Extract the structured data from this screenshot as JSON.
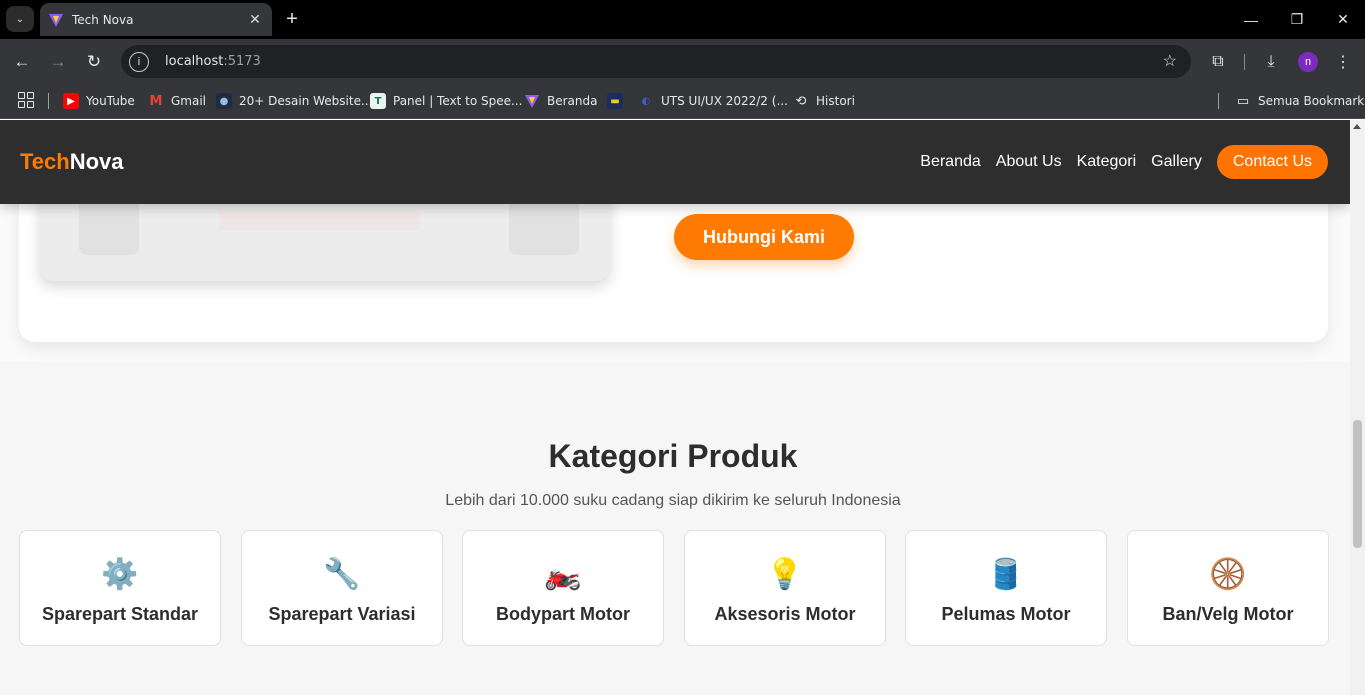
{
  "browser": {
    "tab_title": "Tech Nova",
    "url_host": "localhost",
    "url_port": ":5173",
    "bookmarks": [
      {
        "label": "YouTube",
        "icon": "youtube-icon"
      },
      {
        "label": "Gmail",
        "icon": "gmail-icon"
      },
      {
        "label": "20+ Desain Website...",
        "icon": "site-icon"
      },
      {
        "label": "Panel | Text to Spee...",
        "icon": "t-icon"
      },
      {
        "label": "Beranda",
        "icon": "vite-icon"
      },
      {
        "label": "",
        "icon": "folder-icon"
      },
      {
        "label": "UTS UI/UX 2022/2 (...",
        "icon": "uts-icon"
      },
      {
        "label": "Histori",
        "icon": "history-icon"
      }
    ],
    "all_bookmarks": "Semua Bookmark",
    "profile_initial": "n"
  },
  "site": {
    "logo_part1": "Tech",
    "logo_part2": "Nova",
    "nav": [
      "Beranda",
      "About Us",
      "Kategori",
      "Gallery"
    ],
    "contact": "Contact Us",
    "hero_cta": "Hubungi Kami",
    "section_title": "Kategori Produk",
    "section_subtitle": "Lebih dari 10.000 suku cadang siap dikirim ke seluruh Indonesia",
    "categories": [
      {
        "label": "Sparepart Standar",
        "icon": "⚙️"
      },
      {
        "label": "Sparepart Variasi",
        "icon": "🔧"
      },
      {
        "label": "Bodypart Motor",
        "icon": "🏍️"
      },
      {
        "label": "Aksesoris Motor",
        "icon": "💡"
      },
      {
        "label": "Pelumas Motor",
        "icon": "🛢️"
      },
      {
        "label": "Ban/Velg Motor",
        "icon": "🛞"
      }
    ]
  },
  "colors": {
    "accent": "#ff7a00",
    "nav_bg": "#2e2e2e"
  }
}
